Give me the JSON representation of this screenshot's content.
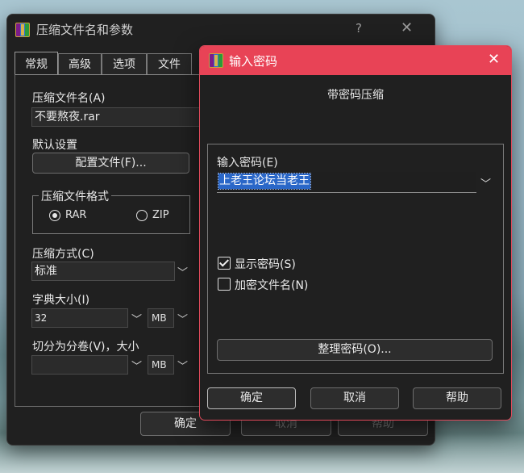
{
  "main_window": {
    "title": "压缩文件名和参数",
    "help_glyph": "?",
    "close_glyph": "✕",
    "tabs": [
      {
        "label": "常规",
        "active": true
      },
      {
        "label": "高级",
        "active": false
      },
      {
        "label": "选项",
        "active": false
      },
      {
        "label": "文件",
        "active": false
      }
    ],
    "archive_name_label": "压缩文件名(A)",
    "archive_name_value": "不要熬夜.rar",
    "default_settings_label": "默认设置",
    "profiles_button": "配置文件(F)...",
    "format_group_title": "压缩文件格式",
    "format_options": [
      {
        "label": "RAR",
        "selected": true
      },
      {
        "label": "ZIP",
        "selected": false
      }
    ],
    "method_label": "压缩方式(C)",
    "method_value": "标准",
    "dict_label": "字典大小(I)",
    "dict_value": "32",
    "dict_unit": "MB",
    "split_label": "切分为分卷(V)，大小",
    "split_value": "",
    "split_unit": "MB",
    "buttons": {
      "ok": "确定",
      "cancel": "取消",
      "help": "帮助"
    }
  },
  "password_dialog": {
    "title": "输入密码",
    "close_glyph": "✕",
    "heading": "带密码压缩",
    "password_label": "输入密码(E)",
    "password_value": "上老王论坛当老王",
    "show_password_label": "显示密码(S)",
    "show_password_checked": true,
    "encrypt_names_label": "加密文件名(N)",
    "encrypt_names_checked": false,
    "organize_button": "整理密码(O)...",
    "buttons": {
      "ok": "确定",
      "cancel": "取消",
      "help": "帮助"
    },
    "accent_color": "#e84356"
  },
  "icons": {
    "chevron": "chevron-down-icon",
    "app": "winrar-icon"
  }
}
